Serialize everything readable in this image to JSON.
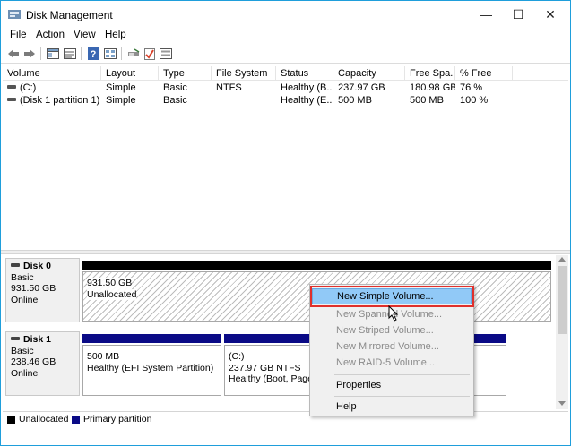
{
  "window": {
    "title": "Disk Management",
    "controls": {
      "minimize": "—",
      "maximize": "☐",
      "close": "✕"
    }
  },
  "menu": [
    "File",
    "Action",
    "View",
    "Help"
  ],
  "toolbar": {
    "icons": [
      "back-arrow-icon",
      "forward-arrow-icon",
      "console-tree-icon",
      "properties-list-icon",
      "help-icon",
      "list-view-icon",
      "connect-icon",
      "check-icon",
      "settings-icon"
    ]
  },
  "volume_table": {
    "columns": [
      "Volume",
      "Layout",
      "Type",
      "File System",
      "Status",
      "Capacity",
      "Free Spa...",
      "% Free"
    ],
    "rows": [
      [
        "(C:)",
        "Simple",
        "Basic",
        "NTFS",
        "Healthy (B...",
        "237.97 GB",
        "180.98 GB",
        "76 %"
      ],
      [
        "(Disk 1 partition 1)",
        "Simple",
        "Basic",
        "",
        "Healthy (E...",
        "500 MB",
        "500 MB",
        "100 %"
      ]
    ]
  },
  "disks": [
    {
      "name": "Disk 0",
      "type": "Basic",
      "size": "931.50 GB",
      "status": "Online",
      "partitions": [
        {
          "line1": "931.50 GB",
          "line2": "Unallocated"
        }
      ]
    },
    {
      "name": "Disk 1",
      "type": "Basic",
      "size": "238.46 GB",
      "status": "Online",
      "partitions": [
        {
          "line0": "",
          "line1": "500 MB",
          "line2": "Healthy (EFI System Partition)"
        },
        {
          "line0": "(C:)",
          "line1": "237.97 GB NTFS",
          "line2": "Healthy (Boot, Page"
        }
      ]
    }
  ],
  "legend": [
    {
      "label": "Unallocated",
      "color": "#000000"
    },
    {
      "label": "Primary partition",
      "color": "#0a0a86"
    }
  ],
  "context_menu": {
    "items": [
      {
        "label": "New Simple Volume...",
        "state": "highlighted"
      },
      {
        "label": "New Spanned Volume...",
        "state": "disabled"
      },
      {
        "label": "New Striped Volume...",
        "state": "disabled"
      },
      {
        "label": "New Mirrored Volume...",
        "state": "disabled"
      },
      {
        "label": "New RAID-5 Volume...",
        "state": "disabled"
      },
      {
        "label": "Properties",
        "state": "enabled"
      },
      {
        "label": "Help",
        "state": "enabled"
      }
    ]
  },
  "colors": {
    "window_border": "#1f9edb",
    "highlight": "#91c9f7",
    "callout": "#e0302c",
    "primary_partition": "#0a0a86"
  }
}
